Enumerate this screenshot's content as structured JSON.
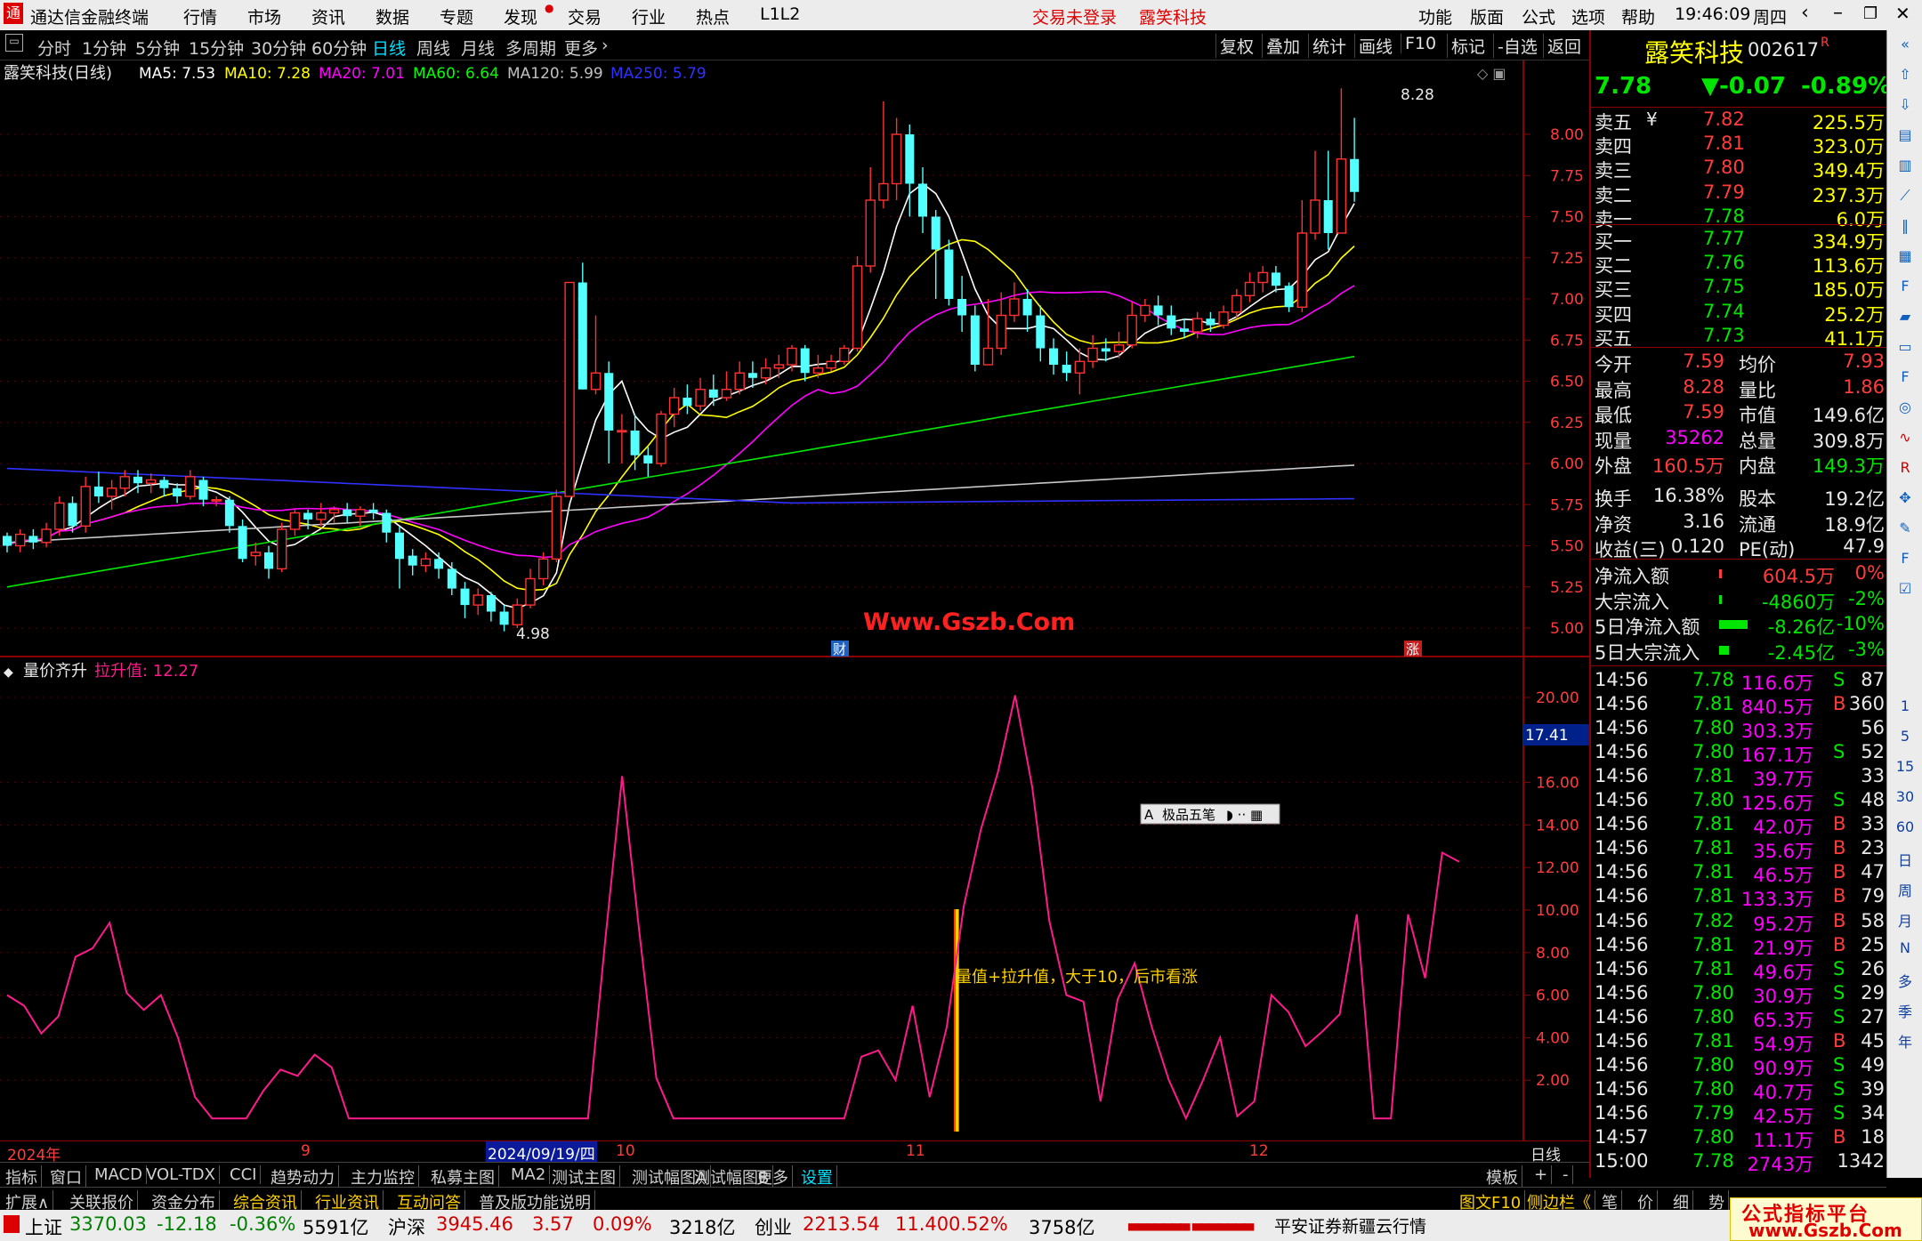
{
  "menubar": {
    "app_title": "通达信金融终端",
    "menus": [
      "行情",
      "市场",
      "资讯",
      "数据",
      "专题",
      "发现",
      "交易",
      "行业",
      "热点",
      "L1L2"
    ],
    "login_status": "交易未登录",
    "stock_name": "露笑科技",
    "right_menus": [
      "功能",
      "版面",
      "公式",
      "选项",
      "帮助"
    ],
    "time": "19:46:09",
    "weekday": "周四"
  },
  "periods": [
    "分时",
    "1分钟",
    "5分钟",
    "15分钟",
    "30分钟",
    "60分钟",
    "日线",
    "周线",
    "月线",
    "多周期",
    "更多"
  ],
  "active_period": "日线",
  "toolbar": [
    "复权",
    "叠加",
    "统计",
    "画线",
    "F10",
    "标记",
    "-自选",
    "返回"
  ],
  "main_chart": {
    "title": "露笑科技(日线)",
    "ma_labels": [
      {
        "text": "MA5: 7.53",
        "color": "#ffffff"
      },
      {
        "text": "MA10: 7.28",
        "color": "#ffff00"
      },
      {
        "text": "MA20: 7.01",
        "color": "#ff00ff"
      },
      {
        "text": "MA60: 6.64",
        "color": "#00ff00"
      },
      {
        "text": "MA120: 5.99",
        "color": "#c0c0c0"
      },
      {
        "text": "MA250: 5.79",
        "color": "#3030ff"
      }
    ],
    "y_ticks": [
      "8.00",
      "7.75",
      "7.50",
      "7.25",
      "7.00",
      "6.75",
      "6.50",
      "6.25",
      "6.00",
      "5.75",
      "5.50",
      "5.25",
      "5.00"
    ],
    "high_label": "8.28",
    "low_label": "4.98",
    "watermark": "Www.Gszb.Com",
    "event_labels": [
      "财",
      "涨"
    ]
  },
  "sub_chart": {
    "title": "量价齐升",
    "value_label": "拉升值: 12.27",
    "y_ticks": [
      "20.00",
      "16.00",
      "14.00",
      "12.00",
      "10.00",
      "8.00",
      "6.00",
      "4.00",
      "2.00"
    ],
    "cursor_value": "17.41",
    "annotation": "量值+拉升值，大于10，后市看涨",
    "ime_label": "极品五笔"
  },
  "x_axis": {
    "labels": [
      "2024年",
      "9",
      "2024/09/19/四",
      "10",
      "11",
      "12"
    ],
    "period": "日线"
  },
  "chart_data": {
    "type": "line",
    "title": "量价齐升",
    "series": [
      {
        "name": "拉升值",
        "values": [
          6.0,
          5.5,
          4.2,
          5.0,
          7.8,
          8.2,
          9.4,
          6.1,
          5.3,
          6.0,
          4.0,
          1.2,
          0.2,
          0.2,
          0.2,
          1.5,
          2.5,
          2.2,
          3.2,
          2.6,
          0.2,
          0.2,
          0.2,
          0.2,
          0.2,
          0.2,
          0.2,
          0.2,
          0.2,
          0.2,
          0.2,
          0.2,
          0.2,
          0.2,
          0.2,
          8.5,
          16.3,
          9.0,
          2.1,
          0.2,
          0.2,
          0.2,
          0.2,
          0.2,
          0.2,
          0.2,
          0.2,
          0.2,
          0.2,
          0.2,
          3.1,
          3.4,
          2.0,
          5.5,
          1.2,
          4.5,
          10.2,
          13.8,
          16.5,
          20.1,
          15.8,
          9.5,
          6.0,
          5.7,
          1.0,
          5.8,
          7.5,
          4.5,
          2.0,
          0.2,
          2.0,
          4.0,
          0.3,
          1.0,
          6.0,
          5.2,
          3.6,
          4.3,
          5.1,
          9.8,
          0.2,
          0.2,
          9.8,
          6.8,
          12.7,
          12.27
        ]
      }
    ],
    "ylim": [
      0,
      21
    ]
  },
  "sell_book": [
    {
      "label": "卖五",
      "price": "7.82",
      "vol": "225.5万"
    },
    {
      "label": "卖四",
      "price": "7.81",
      "vol": "323.0万"
    },
    {
      "label": "卖三",
      "price": "7.80",
      "vol": "349.4万"
    },
    {
      "label": "卖二",
      "price": "7.79",
      "vol": "237.3万"
    },
    {
      "label": "卖一",
      "price": "7.78",
      "vol": "6.0万"
    }
  ],
  "buy_book": [
    {
      "label": "买一",
      "price": "7.77",
      "vol": "334.9万"
    },
    {
      "label": "买二",
      "price": "7.76",
      "vol": "113.6万"
    },
    {
      "label": "买三",
      "price": "7.75",
      "vol": "185.0万"
    },
    {
      "label": "买四",
      "price": "7.74",
      "vol": "25.2万"
    },
    {
      "label": "买五",
      "price": "7.73",
      "vol": "41.1万"
    }
  ],
  "quote": {
    "name": "露笑科技",
    "code": "002617",
    "code_mark": "R",
    "price": "7.78",
    "change": "▼-0.07",
    "change_pct": "-0.89%",
    "sell_yen": "¥"
  },
  "stats": [
    {
      "l1": "今开",
      "v1": "7.59",
      "c1": "red",
      "l2": "均价",
      "v2": "7.93",
      "c2": "red"
    },
    {
      "l1": "最高",
      "v1": "8.28",
      "c1": "red",
      "l2": "量比",
      "v2": "1.86",
      "c2": "red"
    },
    {
      "l1": "最低",
      "v1": "7.59",
      "c1": "red",
      "l2": "市值",
      "v2": "149.6亿",
      "c2": "white"
    },
    {
      "l1": "现量",
      "v1": "35262",
      "c1": "mag",
      "l2": "总量",
      "v2": "309.8万",
      "c2": "white"
    },
    {
      "l1": "外盘",
      "v1": "160.5万",
      "c1": "red",
      "l2": "内盘",
      "v2": "149.3万",
      "c2": "green"
    },
    {
      "l1": "换手",
      "v1": "16.38%",
      "c1": "white",
      "l2": "股本",
      "v2": "19.2亿",
      "c2": "white"
    },
    {
      "l1": "净资",
      "v1": "3.16",
      "c1": "white",
      "l2": "流通",
      "v2": "18.9亿",
      "c2": "white"
    },
    {
      "l1": "收益(三)",
      "v1": "0.120",
      "c1": "white",
      "l2": "PE(动)",
      "v2": "47.9",
      "c2": "white"
    }
  ],
  "flows": [
    {
      "label": "净流入额",
      "value": "604.5万",
      "pct": "0%",
      "color": "red",
      "bar": 0.02
    },
    {
      "label": "大宗流入",
      "value": "-4860万",
      "pct": "-2%",
      "color": "green",
      "bar": 0.02
    },
    {
      "label": "5日净流入额",
      "value": "-8.26亿",
      "pct": "-10%",
      "color": "green",
      "bar": 0.9
    },
    {
      "label": "5日大宗流入",
      "value": "-2.45亿",
      "pct": "-3%",
      "color": "green",
      "bar": 0.3
    }
  ],
  "ticks": [
    {
      "t": "14:56",
      "p": "7.78",
      "v": "116.6万",
      "s": "S",
      "n": "87"
    },
    {
      "t": "14:56",
      "p": "7.81",
      "v": "840.5万",
      "s": "B",
      "n": "360"
    },
    {
      "t": "14:56",
      "p": "7.80",
      "v": "303.3万",
      "s": "",
      "n": "56"
    },
    {
      "t": "14:56",
      "p": "7.80",
      "v": "167.1万",
      "s": "S",
      "n": "52"
    },
    {
      "t": "14:56",
      "p": "7.81",
      "v": "39.7万",
      "s": "",
      "n": "33"
    },
    {
      "t": "14:56",
      "p": "7.80",
      "v": "125.6万",
      "s": "S",
      "n": "48"
    },
    {
      "t": "14:56",
      "p": "7.81",
      "v": "42.0万",
      "s": "B",
      "n": "33"
    },
    {
      "t": "14:56",
      "p": "7.81",
      "v": "35.6万",
      "s": "B",
      "n": "23"
    },
    {
      "t": "14:56",
      "p": "7.81",
      "v": "46.5万",
      "s": "B",
      "n": "47"
    },
    {
      "t": "14:56",
      "p": "7.81",
      "v": "133.3万",
      "s": "B",
      "n": "79"
    },
    {
      "t": "14:56",
      "p": "7.82",
      "v": "95.2万",
      "s": "B",
      "n": "58"
    },
    {
      "t": "14:56",
      "p": "7.81",
      "v": "21.9万",
      "s": "B",
      "n": "25"
    },
    {
      "t": "14:56",
      "p": "7.81",
      "v": "49.6万",
      "s": "S",
      "n": "26"
    },
    {
      "t": "14:56",
      "p": "7.80",
      "v": "30.9万",
      "s": "S",
      "n": "29"
    },
    {
      "t": "14:56",
      "p": "7.80",
      "v": "65.3万",
      "s": "S",
      "n": "27"
    },
    {
      "t": "14:56",
      "p": "7.81",
      "v": "54.9万",
      "s": "B",
      "n": "45"
    },
    {
      "t": "14:56",
      "p": "7.80",
      "v": "90.9万",
      "s": "S",
      "n": "49"
    },
    {
      "t": "14:56",
      "p": "7.80",
      "v": "40.7万",
      "s": "S",
      "n": "39"
    },
    {
      "t": "14:56",
      "p": "7.79",
      "v": "42.5万",
      "s": "S",
      "n": "34"
    },
    {
      "t": "14:57",
      "p": "7.80",
      "v": "11.1万",
      "s": "B",
      "n": "18"
    },
    {
      "t": "15:00",
      "p": "7.78",
      "v": "2743万",
      "s": "",
      "n": "1342"
    }
  ],
  "bottom_tabs": [
    "指标",
    "窗口",
    "MACD",
    "VOL-TDX",
    "CCI",
    "趋势动力",
    "主力监控",
    "私募主图",
    "MA2",
    "测试主图",
    "测试幅图A",
    "测试幅图B",
    "更多",
    "设置"
  ],
  "bottom_right": [
    "模板",
    "+",
    "-"
  ],
  "tabs2": [
    "扩展∧",
    "关联报价",
    "资金分布",
    "综合资讯",
    "行业资讯",
    "互动问答",
    "普及版功能说明"
  ],
  "tabs2_right": [
    "图文F10",
    "侧边栏《",
    "笔",
    "价",
    "细",
    "势"
  ],
  "side_tools": [
    "1",
    "5",
    "15",
    "30",
    "60",
    "日",
    "周",
    "月",
    "N",
    "多",
    "季",
    "年"
  ],
  "statusbar": {
    "sh_label": "上证",
    "sh_val": "3370.03",
    "sh_chg": "-12.18",
    "sh_pct": "-0.36%",
    "sh_amt": "5591亿",
    "hs_label": "沪深",
    "hs_val": "3945.46",
    "hs_chg": "3.57",
    "hs_pct": "0.09%",
    "hs_amt": "3218亿",
    "cy_label": "创业",
    "cy_val": "2213.54",
    "cy_chg": "11.40",
    "cy_pct": "0.52%",
    "cy_amt": "3758亿",
    "broker": "平安证券新疆云行情",
    "brand_top": "公式指标平台",
    "brand_bottom": "www.Gszb.Com"
  }
}
